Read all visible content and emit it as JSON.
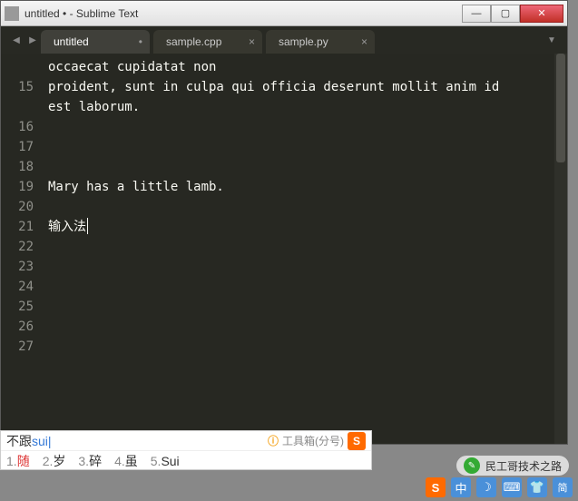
{
  "window": {
    "title": "untitled • - Sublime Text"
  },
  "tabs": {
    "nav_prev": "◀",
    "nav_next": "▶",
    "menu": "▼",
    "items": [
      {
        "label": "untitled",
        "close": "•",
        "active": true
      },
      {
        "label": "sample.cpp",
        "close": "×",
        "active": false
      },
      {
        "label": "sample.py",
        "close": "×",
        "active": false
      }
    ]
  },
  "editor": {
    "first_line": 14,
    "lines": [
      "occaecat cupidatat non",
      "proident, sunt in culpa qui officia deserunt mollit anim id",
      "est laborum.",
      "",
      "",
      "",
      "Mary has a little lamb.",
      "",
      "输入法",
      "",
      "",
      "",
      "",
      "",
      ""
    ],
    "gutter": [
      "",
      "15",
      "",
      "16",
      "17",
      "18",
      "19",
      "20",
      "21",
      "22",
      "23",
      "24",
      "25",
      "26",
      "27"
    ],
    "cursor_line_index": 8
  },
  "ime": {
    "typed_prefix": "不跟",
    "typed_pinyin": "sui",
    "toolbox_icon": "ⓘ",
    "toolbox_label": "工具箱(分号)",
    "logo": "S",
    "candidates": [
      {
        "n": "1.",
        "word": "随",
        "hl": true
      },
      {
        "n": "2.",
        "word": "岁"
      },
      {
        "n": "3.",
        "word": "碎"
      },
      {
        "n": "4.",
        "word": "虽"
      },
      {
        "n": "5.",
        "word": "Sui"
      }
    ]
  },
  "taskbar": {
    "s": "S",
    "cn": "中",
    "moon": "☽",
    "keyboard": "⌨",
    "person": "👕",
    "book": "简"
  },
  "watermark": {
    "icon": "✎",
    "text": "民工哥技术之路"
  }
}
